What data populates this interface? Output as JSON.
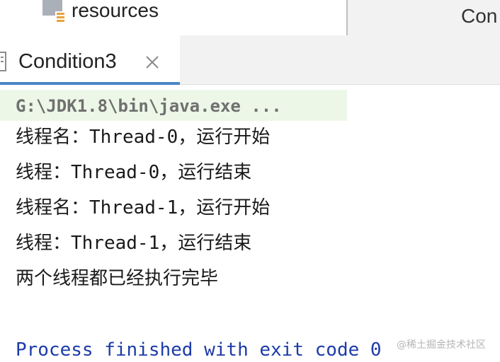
{
  "project_tree": {
    "folder_label": "resources",
    "folder_icon": "resources-folder-icon"
  },
  "editor": {
    "tab_label": "Con"
  },
  "run_window": {
    "tab_label": "Condition3",
    "tab_close": "×",
    "accent_color": "#4a86c7"
  },
  "console": {
    "command": "G:\\JDK1.8\\bin\\java.exe ...",
    "lines": [
      "线程名：Thread-0，运行开始",
      "线程：Thread-0，运行结束",
      "线程名：Thread-1，运行开始",
      "线程：Thread-1，运行结束",
      "两个线程都已经执行完毕"
    ],
    "exit_message": "Process finished with exit code 0",
    "exit_color": "#1d3ba8"
  },
  "watermark": "@稀土掘金技术社区"
}
